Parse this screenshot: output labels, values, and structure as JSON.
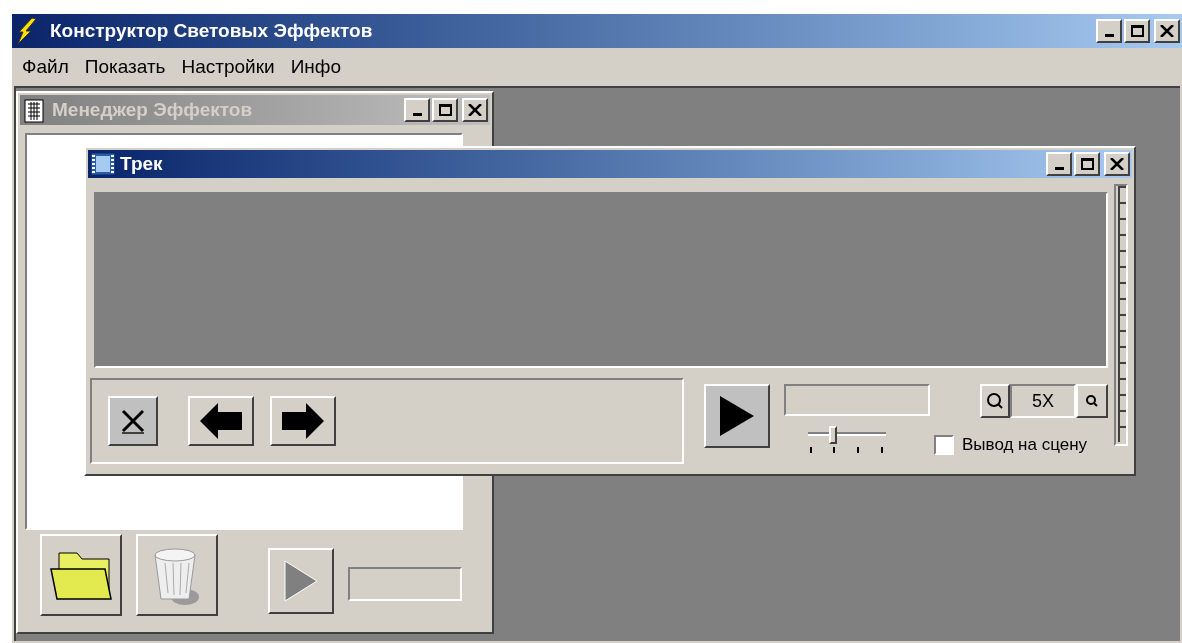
{
  "window": {
    "title": "Конструктор Световых Эффектов"
  },
  "menu": [
    {
      "label": "Файл"
    },
    {
      "label": "Показать"
    },
    {
      "label": "Настройки"
    },
    {
      "label": "Инфо"
    }
  ],
  "child_windows": [
    {
      "kind": "manager",
      "title": "Менеджер Эффектов",
      "active": false,
      "play_disabled": true
    },
    {
      "kind": "track",
      "title": "Трек",
      "active": true,
      "zoom_label": "5X",
      "slider": {
        "level": 0.3
      },
      "checkbox": {
        "label": "Вывод на сцену",
        "checked": false
      }
    }
  ]
}
